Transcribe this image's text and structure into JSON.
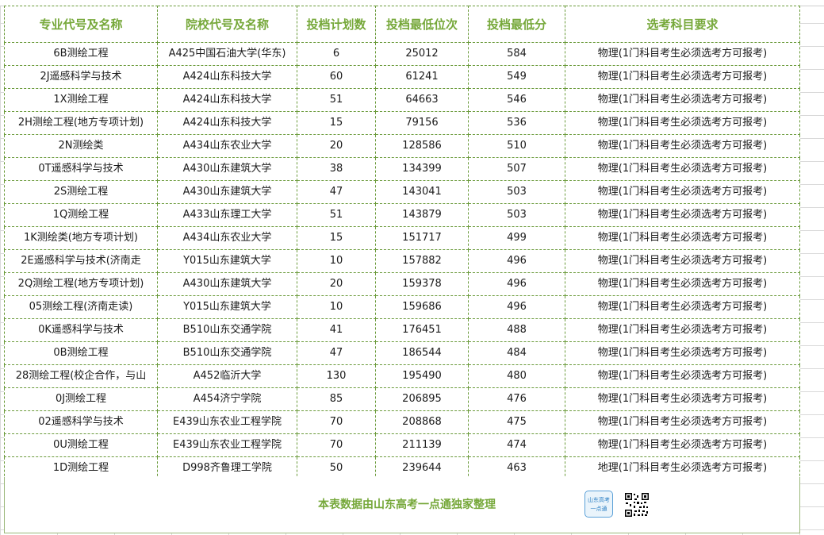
{
  "table": {
    "headers": [
      "专业代号及名称",
      "院校代号及名称",
      "投档计划数",
      "投档最低位次",
      "投档最低分",
      "选考科目要求"
    ],
    "rows": [
      [
        "6B测绘工程",
        "A425中国石油大学(华东)",
        "6",
        "25012",
        "584",
        "物理(1门科目考生必须选考方可报考)"
      ],
      [
        "2J遥感科学与技术",
        "A424山东科技大学",
        "60",
        "61241",
        "549",
        "物理(1门科目考生必须选考方可报考)"
      ],
      [
        "1X测绘工程",
        "A424山东科技大学",
        "51",
        "64663",
        "546",
        "物理(1门科目考生必须选考方可报考)"
      ],
      [
        "2H测绘工程(地方专项计划)",
        "A424山东科技大学",
        "15",
        "79156",
        "536",
        "物理(1门科目考生必须选考方可报考)"
      ],
      [
        "2N测绘类",
        "A434山东农业大学",
        "20",
        "128586",
        "510",
        "物理(1门科目考生必须选考方可报考)"
      ],
      [
        "0T遥感科学与技术",
        "A430山东建筑大学",
        "38",
        "134399",
        "507",
        "物理(1门科目考生必须选考方可报考)"
      ],
      [
        "2S测绘工程",
        "A430山东建筑大学",
        "47",
        "143041",
        "503",
        "物理(1门科目考生必须选考方可报考)"
      ],
      [
        "1Q测绘工程",
        "A433山东理工大学",
        "51",
        "143879",
        "503",
        "物理(1门科目考生必须选考方可报考)"
      ],
      [
        "1K测绘类(地方专项计划)",
        "A434山东农业大学",
        "15",
        "151717",
        "499",
        "物理(1门科目考生必须选考方可报考)"
      ],
      [
        "2E遥感科学与技术(济南走",
        "Y015山东建筑大学",
        "10",
        "157882",
        "496",
        "物理(1门科目考生必须选考方可报考)"
      ],
      [
        "2Q测绘工程(地方专项计划)",
        "A430山东建筑大学",
        "20",
        "159378",
        "496",
        "物理(1门科目考生必须选考方可报考)"
      ],
      [
        "05测绘工程(济南走读)",
        "Y015山东建筑大学",
        "10",
        "159686",
        "496",
        "物理(1门科目考生必须选考方可报考)"
      ],
      [
        "0K遥感科学与技术",
        "B510山东交通学院",
        "41",
        "176451",
        "488",
        "物理(1门科目考生必须选考方可报考)"
      ],
      [
        "0B测绘工程",
        "B510山东交通学院",
        "47",
        "186544",
        "484",
        "物理(1门科目考生必须选考方可报考)"
      ],
      [
        "28测绘工程(校企合作，与山",
        "A452临沂大学",
        "130",
        "195490",
        "480",
        "物理(1门科目考生必须选考方可报考)"
      ],
      [
        "0J测绘工程",
        "A454济宁学院",
        "85",
        "206895",
        "476",
        "物理(1门科目考生必须选考方可报考)"
      ],
      [
        "02遥感科学与技术",
        "E439山东农业工程学院",
        "70",
        "208868",
        "475",
        "物理(1门科目考生必须选考方可报考)"
      ],
      [
        "0U测绘工程",
        "E439山东农业工程学院",
        "70",
        "211139",
        "474",
        "物理(1门科目考生必须选考方可报考)"
      ],
      [
        "1D测绘工程",
        "D998齐鲁理工学院",
        "50",
        "239644",
        "463",
        "地理(1门科目考生必须选考方可报考)"
      ]
    ]
  },
  "footer": {
    "note": "本表数据由山东高考一点通独家整理",
    "logo_line1": "山东高考",
    "logo_line2": "一点通"
  },
  "colors": {
    "header_text": "#76a83a",
    "border": "#6a9a3a"
  },
  "icons": {
    "logo": "shandong-gaokao-logo-icon",
    "qr": "qr-code-icon"
  }
}
